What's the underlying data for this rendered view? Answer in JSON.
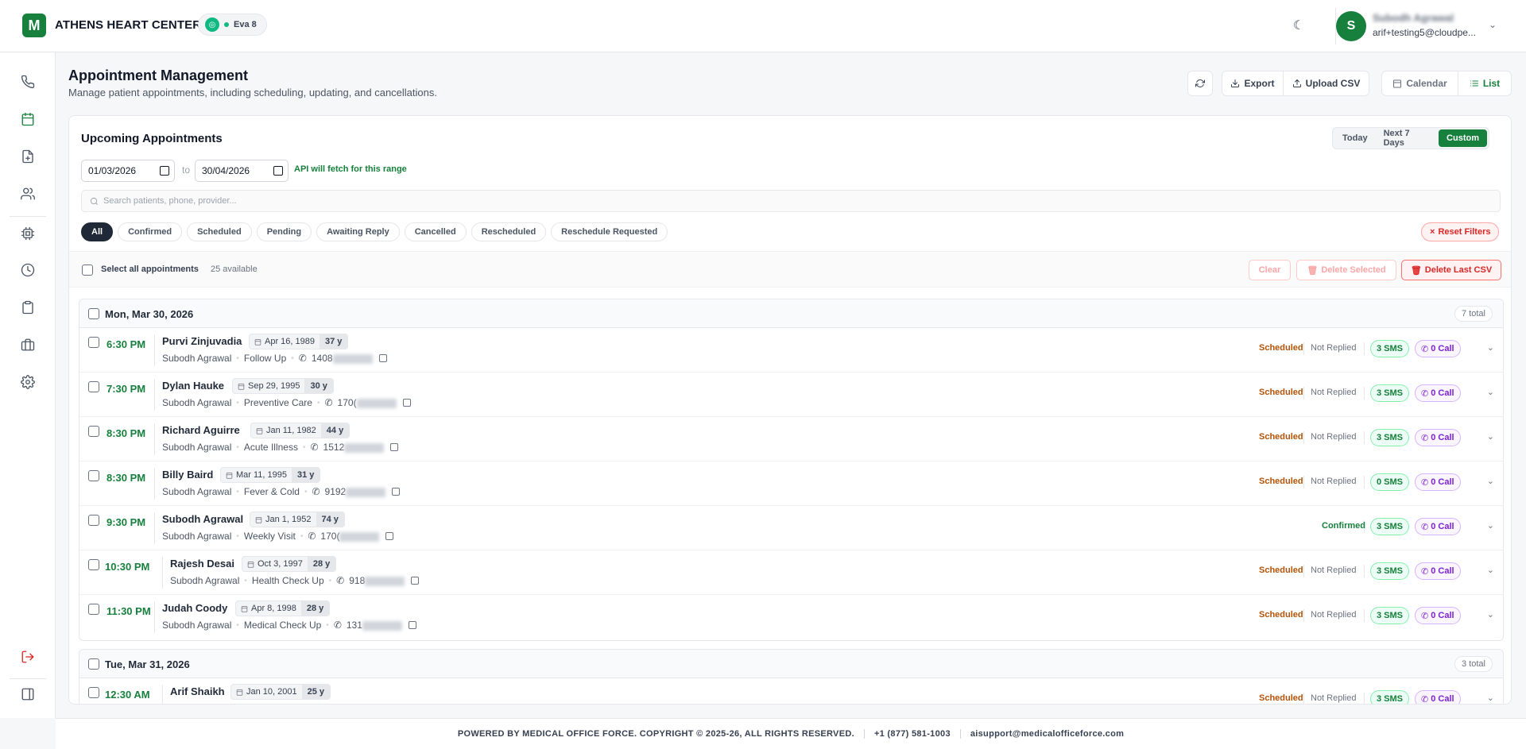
{
  "header": {
    "logo_letter": "M",
    "brand": "ATHENS HEART CENTER",
    "agent": "Eva 8",
    "user_initial": "S",
    "user_name": "Subodh Agrawal",
    "user_email": "arif+testing5@cloudpe..."
  },
  "page": {
    "title": "Appointment Management",
    "subtitle": "Manage patient appointments, including scheduling, updating, and cancellations.",
    "export_label": "Export",
    "upload_label": "Upload CSV",
    "calendar_label": "Calendar",
    "list_label": "List"
  },
  "panel": {
    "title": "Upcoming Appointments",
    "ranges": [
      "Today",
      "Next 7 Days",
      "Custom"
    ],
    "date_from": "01/03/2026",
    "date_to": "30/04/2026",
    "to_label": "to",
    "api_note": "API will fetch for this range",
    "search_placeholder": "Search patients, phone, provider...",
    "filters": [
      "All",
      "Confirmed",
      "Scheduled",
      "Pending",
      "Awaiting Reply",
      "Cancelled",
      "Rescheduled",
      "Reschedule Requested"
    ],
    "reset_label": "Reset Filters",
    "select_all_label": "Select all appointments",
    "available_count": "25 available",
    "clear_label": "Clear",
    "delete_selected_label": "Delete Selected",
    "delete_csv_label": "Delete Last CSV"
  },
  "groups": [
    {
      "date": "Mon, Mar 30, 2026",
      "total": "7 total",
      "rows": [
        {
          "time": "6:30 PM",
          "name": "Purvi Zinjuvadia",
          "dob": "Apr 16, 1989",
          "age": "37 y",
          "provider": "Subodh Agrawal",
          "visit": "Follow Up",
          "phone": "1408",
          "status": "Scheduled",
          "reply": "Not Replied",
          "sms": "3 SMS",
          "call": "0 Call"
        },
        {
          "time": "7:30 PM",
          "name": "Dylan Hauke",
          "dob": "Sep 29, 1995",
          "age": "30 y",
          "provider": "Subodh Agrawal",
          "visit": "Preventive Care",
          "phone": "170(",
          "status": "Scheduled",
          "reply": "Not Replied",
          "sms": "3 SMS",
          "call": "0 Call"
        },
        {
          "time": "8:30 PM",
          "name": "Richard Aguirre",
          "dob": "Jan 11, 1982",
          "age": "44 y",
          "provider": "Subodh Agrawal",
          "visit": "Acute Illness",
          "phone": "1512",
          "status": "Scheduled",
          "reply": "Not Replied",
          "sms": "3 SMS",
          "call": "0 Call"
        },
        {
          "time": "8:30 PM",
          "name": "Billy Baird",
          "dob": "Mar 11, 1995",
          "age": "31 y",
          "provider": "Subodh Agrawal",
          "visit": "Fever & Cold",
          "phone": "9192",
          "status": "Scheduled",
          "reply": "Not Replied",
          "sms": "0 SMS",
          "call": "0 Call"
        },
        {
          "time": "9:30 PM",
          "name": "Subodh Agrawal",
          "dob": "Jan 1, 1952",
          "age": "74 y",
          "provider": "Subodh Agrawal",
          "visit": "Weekly Visit",
          "phone": "170(",
          "status": "Confirmed",
          "reply": "",
          "sms": "3 SMS",
          "call": "0 Call"
        },
        {
          "time": "10:30 PM",
          "name": "Rajesh Desai",
          "dob": "Oct 3, 1997",
          "age": "28 y",
          "provider": "Subodh Agrawal",
          "visit": "Health Check Up",
          "phone": "918",
          "status": "Scheduled",
          "reply": "Not Replied",
          "sms": "3 SMS",
          "call": "0 Call"
        },
        {
          "time": "11:30 PM",
          "name": "Judah Coody",
          "dob": "Apr 8, 1998",
          "age": "28 y",
          "provider": "Subodh Agrawal",
          "visit": "Medical Check Up",
          "phone": "131",
          "status": "Scheduled",
          "reply": "Not Replied",
          "sms": "3 SMS",
          "call": "0 Call"
        }
      ]
    },
    {
      "date": "Tue, Mar 31, 2026",
      "total": "3 total",
      "rows": [
        {
          "time": "12:30 AM",
          "name": "Arif Shaikh",
          "dob": "Jan 10, 2001",
          "age": "25 y",
          "provider": "",
          "visit": "",
          "phone": "",
          "status": "Scheduled",
          "reply": "Not Replied",
          "sms": "3 SMS",
          "call": "0 Call"
        }
      ]
    }
  ],
  "footer": {
    "copyright": "POWERED BY MEDICAL OFFICE FORCE. COPYRIGHT © 2025-26, ALL RIGHTS RESERVED.",
    "phone": "+1 (877) 581-1003",
    "email": "aisupport@medicalofficeforce.com"
  }
}
